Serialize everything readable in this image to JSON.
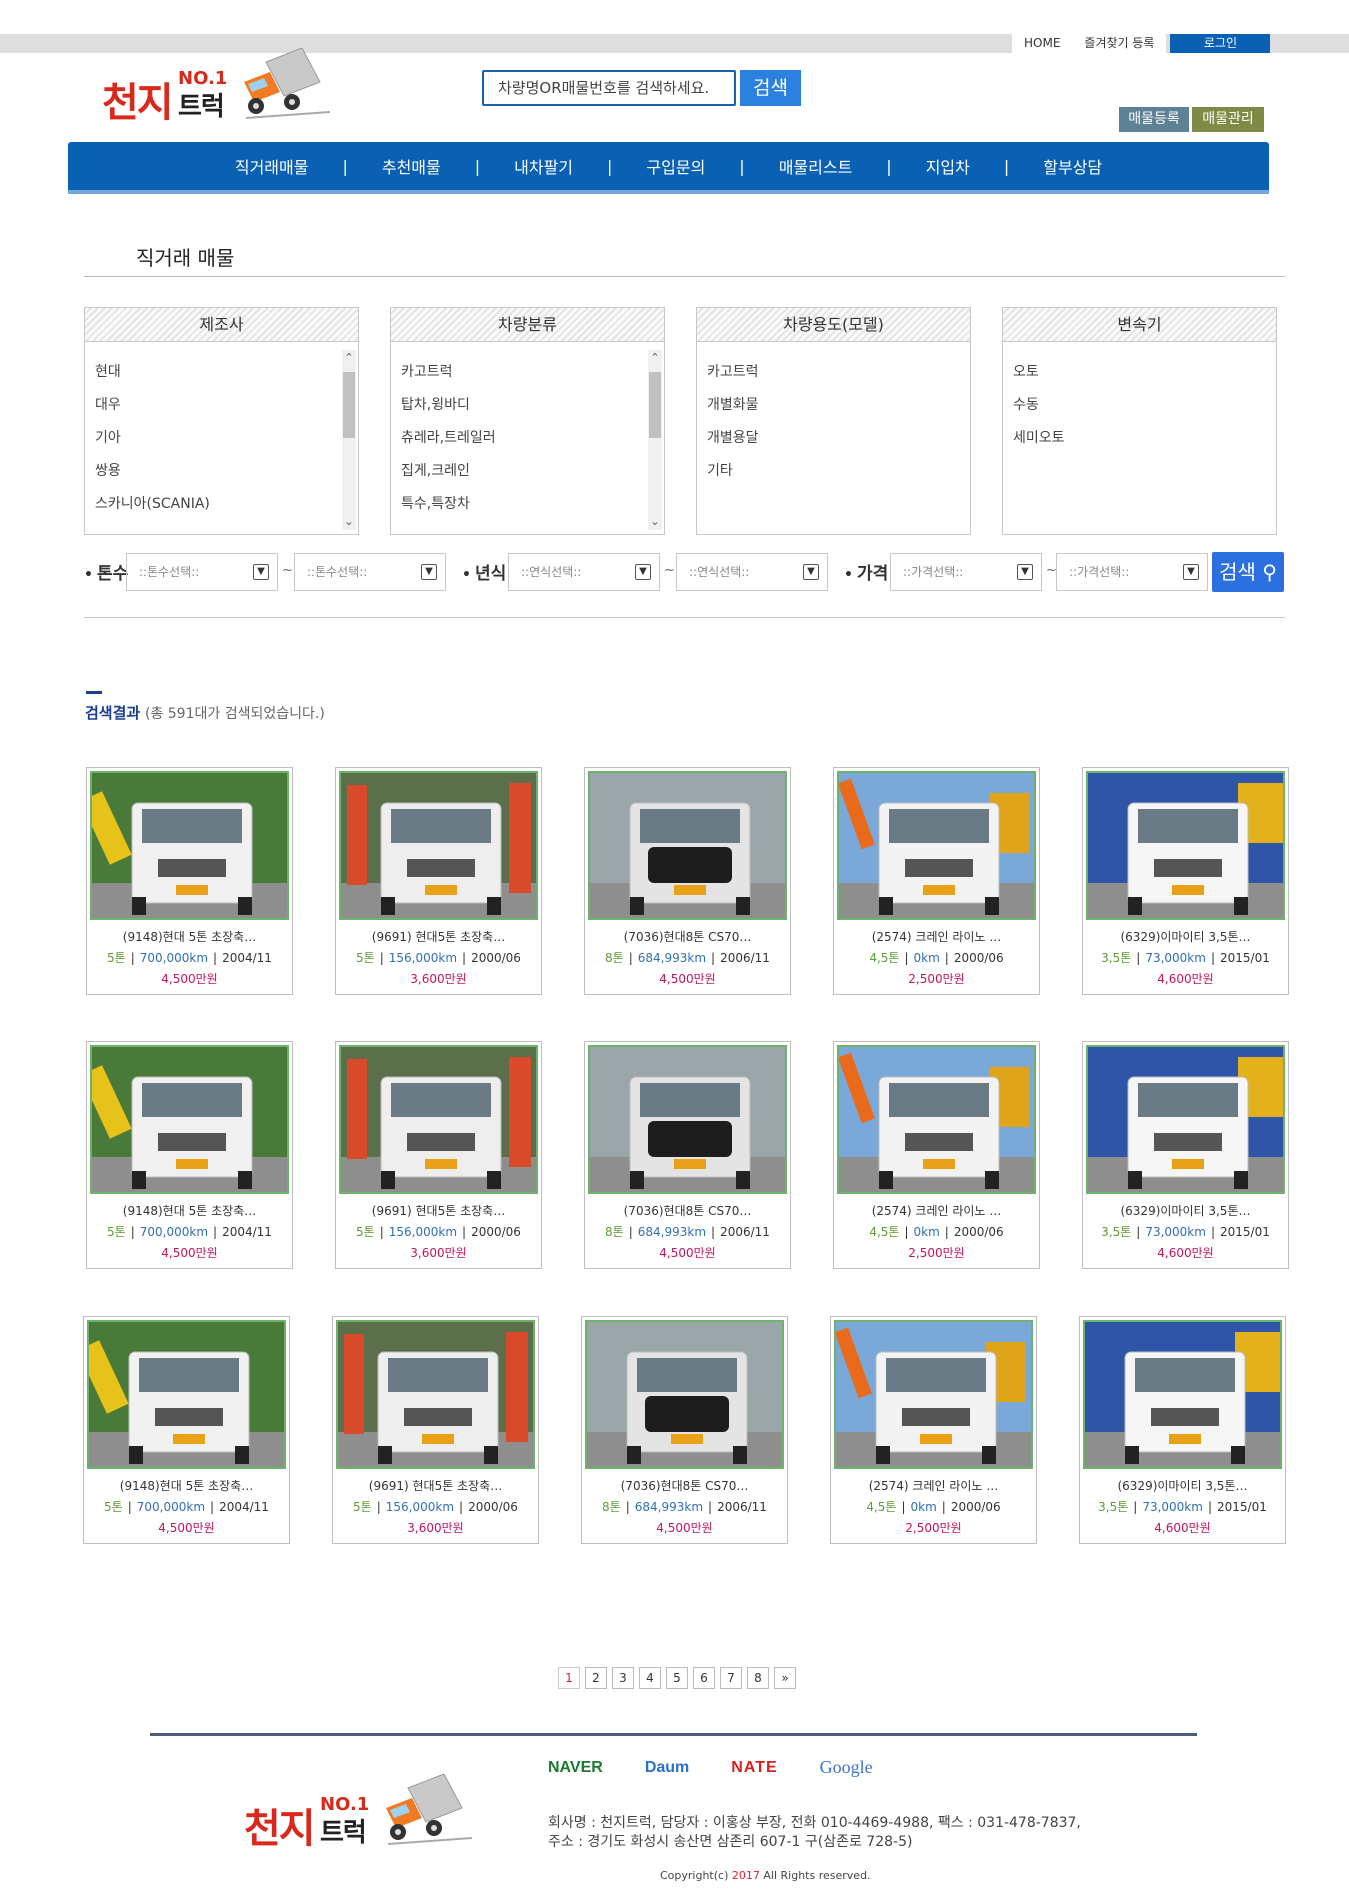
{
  "top_links": {
    "home": "HOME",
    "bookmark": "즐겨찾기 등록",
    "login": "로그인"
  },
  "logo": {
    "main": "천지",
    "no1": "NO.1",
    "truck": "트럭"
  },
  "search": {
    "placeholder": "차량명OR매물번호를 검색하세요.",
    "button": "검색"
  },
  "actions": {
    "register": "매물등록",
    "manage": "매물관리"
  },
  "nav": [
    {
      "label": "직거래매물"
    },
    {
      "label": "추천매물"
    },
    {
      "label": "내차팔기"
    },
    {
      "label": "구입문의"
    },
    {
      "label": "매물리스트"
    },
    {
      "label": "지입차"
    },
    {
      "label": "할부상담"
    }
  ],
  "nav_separator": "|",
  "page_title": "직거래 매물",
  "filters": [
    {
      "title": "제조사",
      "items": [
        "현대",
        "대우",
        "기아",
        "쌍용",
        "스카니아(SCANIA)"
      ],
      "scroll": true
    },
    {
      "title": "차량분류",
      "items": [
        "카고트럭",
        "탑차,윙바디",
        "츄레라,트레일러",
        "집게,크레인",
        "특수,특장차"
      ],
      "scroll": true
    },
    {
      "title": "차량용도(모델)",
      "items": [
        "카고트럭",
        "개별화물",
        "개별용달",
        "기타"
      ],
      "scroll": false
    },
    {
      "title": "변속기",
      "items": [
        "오토",
        "수동",
        "세미오토"
      ],
      "scroll": false
    }
  ],
  "range": {
    "dot": "•",
    "tonnage_label": "톤수",
    "tonnage_placeholder": "::톤수선택::",
    "year_label": "년식",
    "year_placeholder": "::연식선택::",
    "price_label": "가격",
    "price_placeholder": "::가격선택::",
    "tilde": "~",
    "search_button": "검색"
  },
  "results": {
    "label": "검색결과",
    "summary": "(총 591대가 검색되었습니다.)"
  },
  "listing_rows": [
    [
      {
        "name": "(9148)현대 5톤 초장축…",
        "ton": "5톤",
        "km": "700,000km",
        "date": "2004/11",
        "price": "4,500만원"
      },
      {
        "name": "(9691) 현대5톤 초장축…",
        "ton": "5톤",
        "km": "156,000km",
        "date": "2000/06",
        "price": "3,600만원"
      },
      {
        "name": "(7036)현대8톤 CS70…",
        "ton": "8톤",
        "km": "684,993km",
        "date": "2006/11",
        "price": "4,500만원"
      },
      {
        "name": "(2574) 크레인 라이노 …",
        "ton": "4,5톤",
        "km": "0km",
        "date": "2000/06",
        "price": "2,500만원"
      },
      {
        "name": "(6329)이마이티 3,5톤…",
        "ton": "3,5톤",
        "km": "73,000km",
        "date": "2015/01",
        "price": "4,600만원"
      }
    ],
    [
      {
        "name": "(9148)현대 5톤 초장축…",
        "ton": "5톤",
        "km": "700,000km",
        "date": "2004/11",
        "price": "4,500만원"
      },
      {
        "name": "(9691) 현대5톤 초장축…",
        "ton": "5톤",
        "km": "156,000km",
        "date": "2000/06",
        "price": "3,600만원"
      },
      {
        "name": "(7036)현대8톤 CS70…",
        "ton": "8톤",
        "km": "684,993km",
        "date": "2006/11",
        "price": "4,500만원"
      },
      {
        "name": "(2574) 크레인 라이노 …",
        "ton": "4,5톤",
        "km": "0km",
        "date": "2000/06",
        "price": "2,500만원"
      },
      {
        "name": "(6329)이마이티 3,5톤…",
        "ton": "3,5톤",
        "km": "73,000km",
        "date": "2015/01",
        "price": "4,600만원"
      }
    ],
    [
      {
        "name": "(9148)현대 5톤 초장축…",
        "ton": "5톤",
        "km": "700,000km",
        "date": "2004/11",
        "price": "4,500만원"
      },
      {
        "name": "(9691) 현대5톤 초장축…",
        "ton": "5톤",
        "km": "156,000km",
        "date": "2000/06",
        "price": "3,600만원"
      },
      {
        "name": "(7036)현대8톤 CS70…",
        "ton": "8톤",
        "km": "684,993km",
        "date": "2006/11",
        "price": "4,500만원"
      },
      {
        "name": "(2574) 크레인 라이노 …",
        "ton": "4,5톤",
        "km": "0km",
        "date": "2000/06",
        "price": "2,500만원"
      },
      {
        "name": "(6329)이마이티 3,5톤…",
        "ton": "3,5톤",
        "km": "73,000km",
        "date": "2015/01",
        "price": "4,600만원"
      }
    ]
  ],
  "pagination": {
    "pages": [
      "1",
      "2",
      "3",
      "4",
      "5",
      "6",
      "7",
      "8"
    ],
    "current": "1",
    "next": "»"
  },
  "footer": {
    "portals": [
      "NAVER",
      "Daum",
      "NATE",
      "Google"
    ],
    "line1": "회사명 : 천지트럭,      담당자 : 이홍상 부장,      전화 010-4469-4988,      팩스 : 031-478-7837,",
    "line2": "주소 : 경기도 화성시 송산면 삼존리 607-1   구(삼존로 728-5)",
    "copyright_prefix": "Copyright(c)",
    "copyright_year": "2017",
    "copyright_suffix": "All Rights reserved."
  },
  "colors": {
    "nav_blue": "#0a61b3",
    "search_blue": "#2b80e0",
    "logo_red": "#d8291d",
    "ton_green": "#5b9b32",
    "km_blue": "#2f6fb5",
    "price_magenta": "#c4155f",
    "card_photo_border": "#6cb46c"
  }
}
